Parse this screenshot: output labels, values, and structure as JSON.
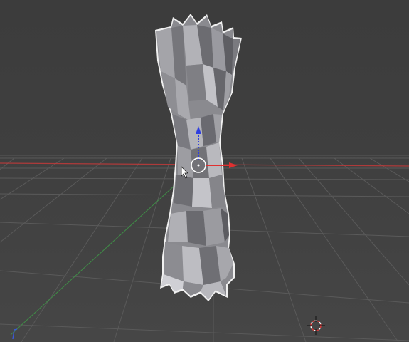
{
  "viewport": {
    "background": "#3f3f3f",
    "grid_color": "#5a5a5a",
    "x_axis_color": "#d43a3a",
    "y_axis_color": "#3fa04a",
    "z_axis_color": "#2f3fe0",
    "selection_outline_color": "#f2f2f2"
  },
  "object": {
    "shape": "twisted-column",
    "selected": true,
    "base_color": "#8d8d92"
  },
  "gizmo": {
    "pivot_icon": "transform-pivot-circle",
    "arrows": [
      "x-arrow",
      "z-arrow"
    ]
  },
  "cursor": {
    "icon": "mouse-pointer-arrow"
  },
  "scene": {
    "cursor_icon": "3d-cursor-crosshair"
  }
}
